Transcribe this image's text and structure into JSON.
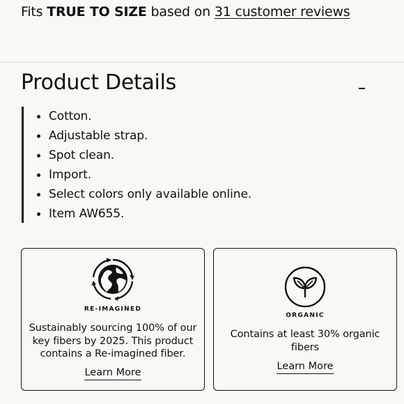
{
  "fit": {
    "prefix": "Fits",
    "emphasis": "TRUE TO SIZE",
    "middle": "based on",
    "link": "31 customer reviews"
  },
  "product_details": {
    "title": "Product Details",
    "toggle_icon": "minus-icon",
    "items": [
      "Cotton.",
      "Adjustable strap.",
      "Spot clean.",
      "Import.",
      "Select colors only available online.",
      "Item AW655."
    ]
  },
  "cards": [
    {
      "icon": "globe-recycle-icon",
      "label": "RE-IMAGINED",
      "text": "Sustainably sourcing 100% of our key fibers by 2025. This product contains a Re-imagined fiber.",
      "link": "Learn More"
    },
    {
      "icon": "leaf-sprout-icon",
      "label": "ORGANIC",
      "text": "Contains at least 30% organic fibers",
      "link": "Learn More"
    }
  ],
  "colors": {
    "background": "#faf8f5",
    "text": "#111111",
    "divider": "#dcd9d5"
  }
}
